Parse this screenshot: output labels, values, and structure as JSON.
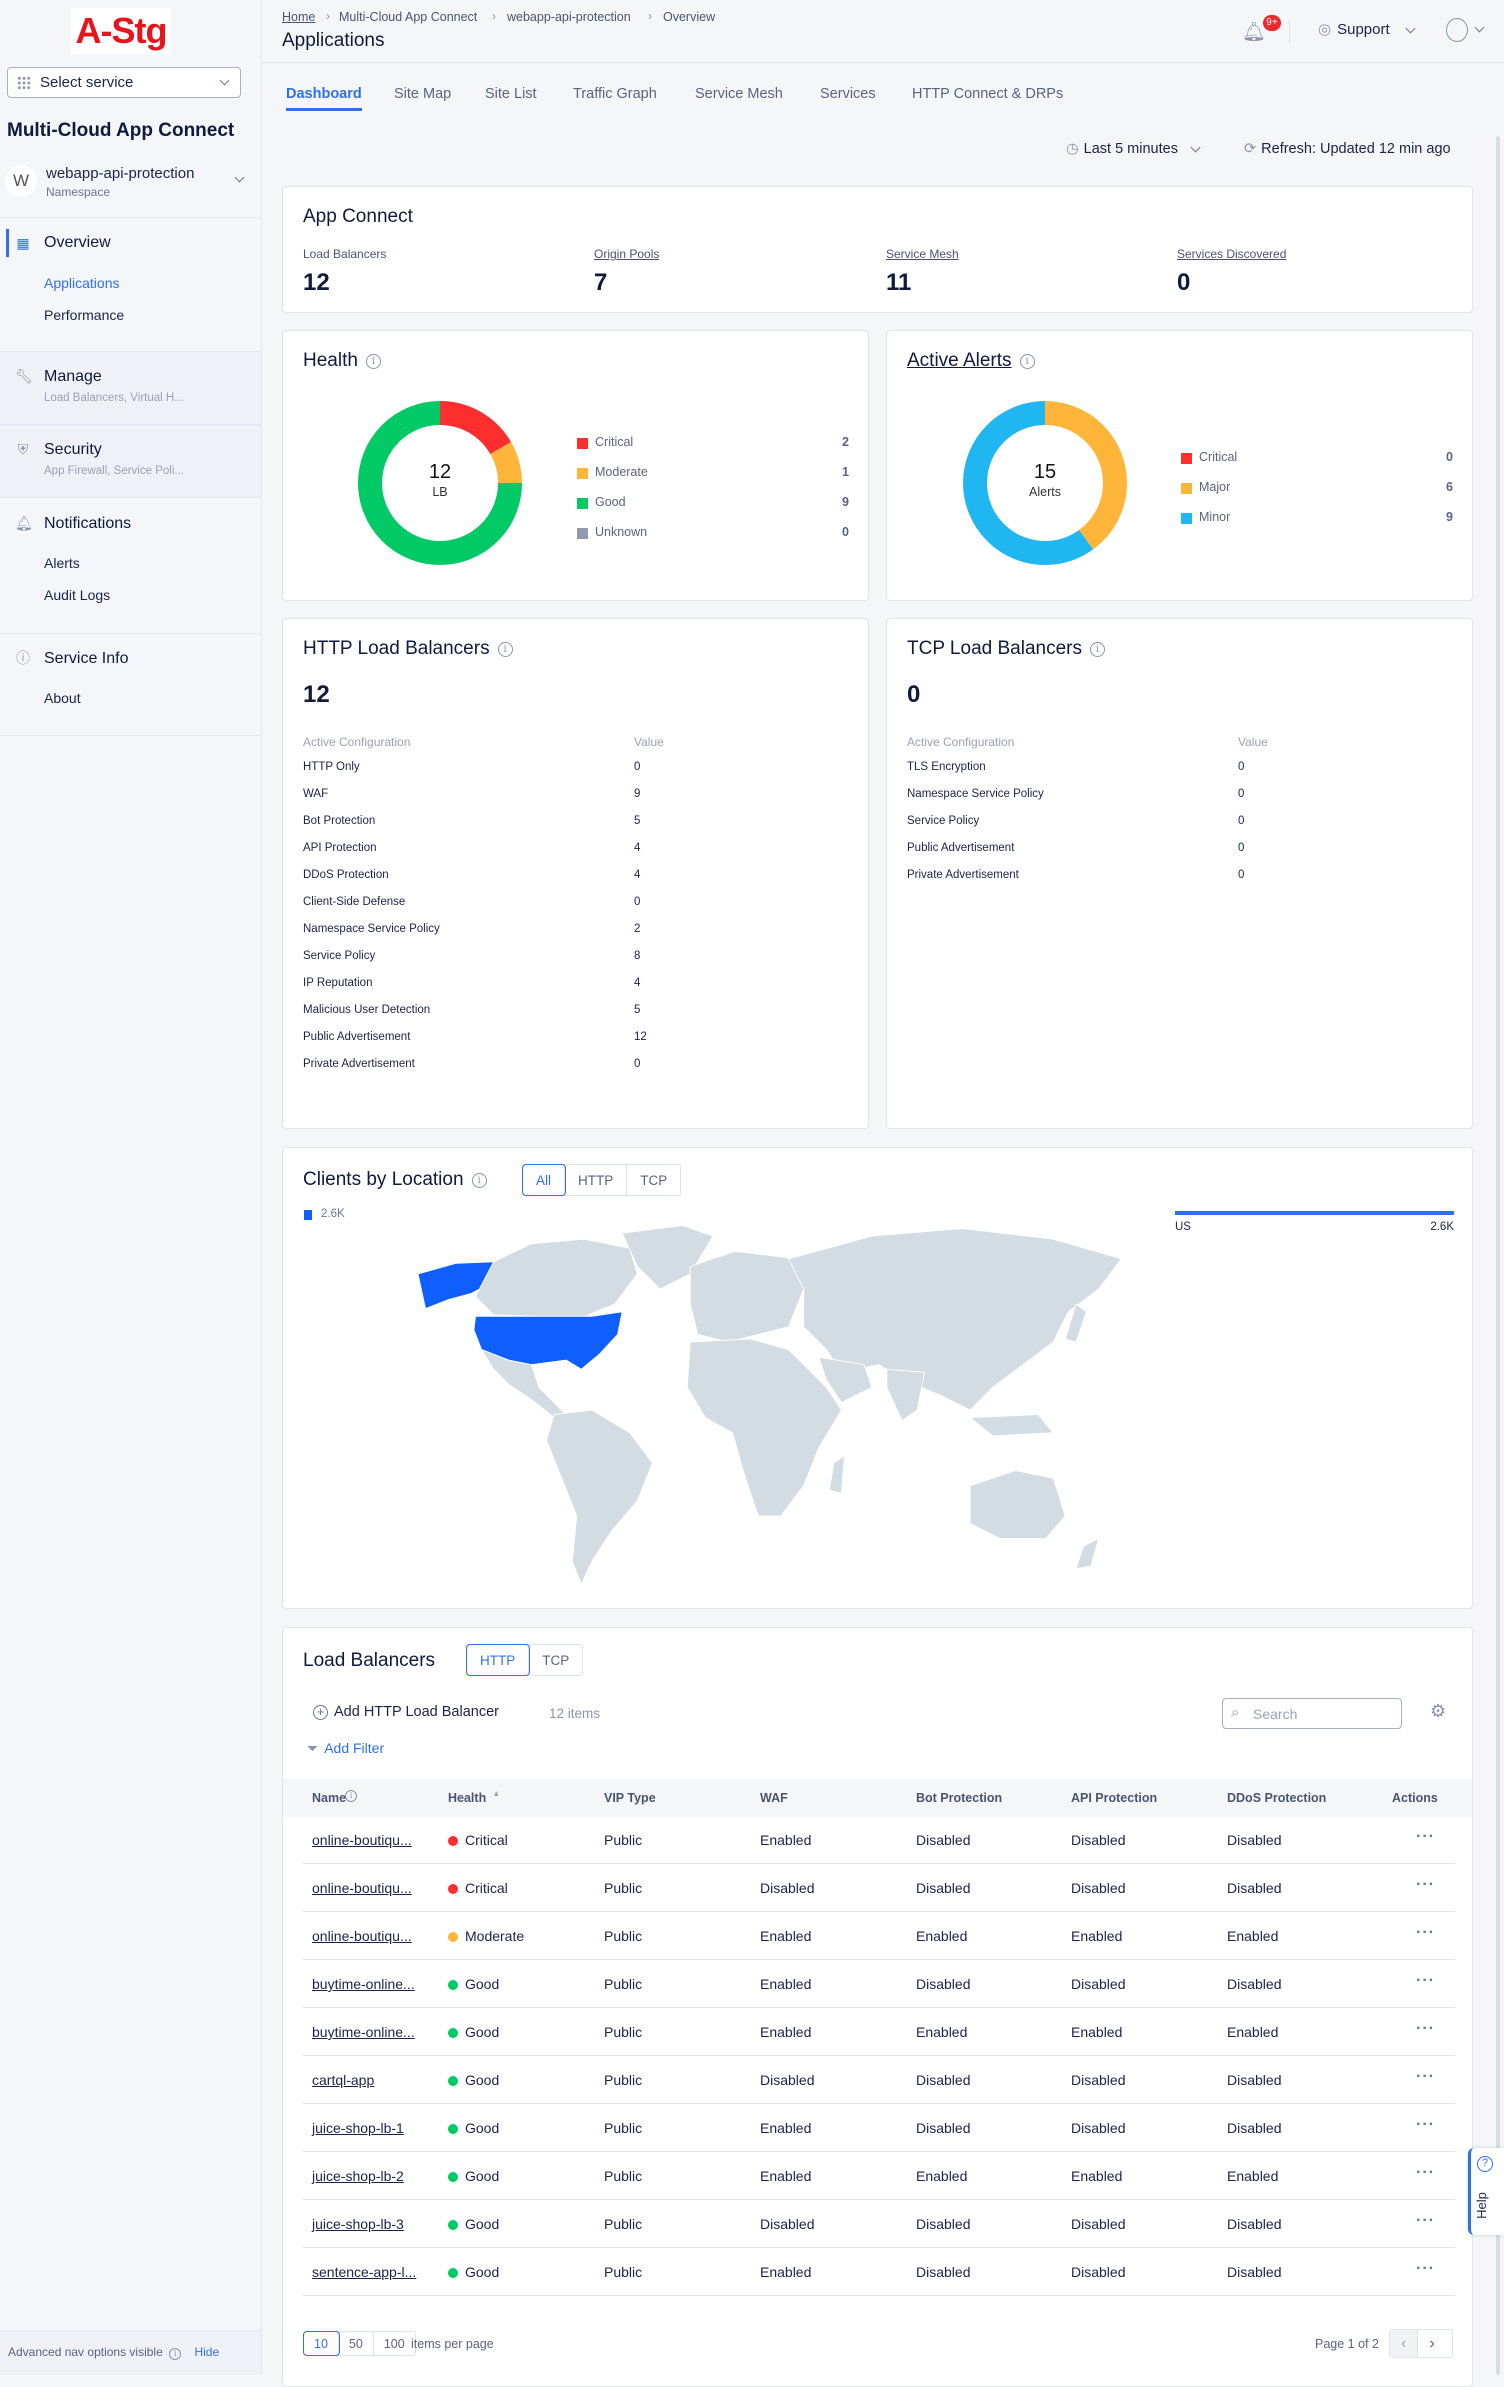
{
  "sidebar": {
    "logo_text": "A-Stg",
    "select_service": "Select service",
    "app_title": "Multi-Cloud App Connect",
    "namespace": {
      "initial": "W",
      "name": "webapp-api-protection",
      "label": "Namespace"
    },
    "overview": {
      "label": "Overview",
      "items": [
        "Applications",
        "Performance"
      ],
      "active_item": "Applications"
    },
    "manage": {
      "label": "Manage",
      "sub": "Load Balancers, Virtual H..."
    },
    "security": {
      "label": "Security",
      "sub": "App Firewall, Service Poli..."
    },
    "notifications": {
      "label": "Notifications",
      "items": [
        "Alerts",
        "Audit Logs"
      ]
    },
    "service_info": {
      "label": "Service Info",
      "items": [
        "About"
      ]
    },
    "footer": {
      "text": "Advanced nav options visible",
      "hide": "Hide"
    }
  },
  "header": {
    "breadcrumb": [
      "Home",
      "Multi-Cloud App Connect",
      "webapp-api-protection",
      "Overview"
    ],
    "title": "Applications",
    "notification_badge": "9+",
    "support": "Support",
    "tabs": [
      "Dashboard",
      "Site Map",
      "Site List",
      "Traffic Graph",
      "Service Mesh",
      "Services",
      "HTTP Connect & DRPs"
    ],
    "active_tab": "Dashboard"
  },
  "toolbar": {
    "time_range": "Last 5 minutes",
    "refresh": "Refresh: Updated 12 min ago"
  },
  "app_connect": {
    "title": "App Connect",
    "stats": [
      {
        "label": "Load Balancers",
        "value": "12",
        "link": false
      },
      {
        "label": "Origin Pools",
        "value": "7",
        "link": true
      },
      {
        "label": "Service Mesh",
        "value": "11",
        "link": true
      },
      {
        "label": "Services Discovered",
        "value": "0",
        "link": true
      }
    ]
  },
  "health": {
    "title": "Health",
    "center_value": "12",
    "center_label": "LB",
    "items": [
      {
        "label": "Critical",
        "value": 2,
        "color": "#ff2e2e"
      },
      {
        "label": "Moderate",
        "value": 1,
        "color": "#ffb53a"
      },
      {
        "label": "Good",
        "value": 9,
        "color": "#00c965"
      },
      {
        "label": "Unknown",
        "value": 0,
        "color": "#9099ad"
      }
    ]
  },
  "alerts": {
    "title": "Active Alerts",
    "center_value": "15",
    "center_label": "Alerts",
    "items": [
      {
        "label": "Critical",
        "value": 0,
        "color": "#ff2e2e"
      },
      {
        "label": "Major",
        "value": 6,
        "color": "#ffb53a"
      },
      {
        "label": "Minor",
        "value": 9,
        "color": "#1fb6f2"
      }
    ]
  },
  "http_lb": {
    "title": "HTTP Load Balancers",
    "total": "12",
    "col_config": "Active Configuration",
    "col_value": "Value",
    "rows": [
      [
        "HTTP Only",
        "0"
      ],
      [
        "WAF",
        "9"
      ],
      [
        "Bot Protection",
        "5"
      ],
      [
        "API Protection",
        "4"
      ],
      [
        "DDoS Protection",
        "4"
      ],
      [
        "Client-Side Defense",
        "0"
      ],
      [
        "Namespace Service Policy",
        "2"
      ],
      [
        "Service Policy",
        "8"
      ],
      [
        "IP Reputation",
        "4"
      ],
      [
        "Malicious User Detection",
        "5"
      ],
      [
        "Public Advertisement",
        "12"
      ],
      [
        "Private Advertisement",
        "0"
      ]
    ]
  },
  "tcp_lb": {
    "title": "TCP Load Balancers",
    "total": "0",
    "col_config": "Active Configuration",
    "col_value": "Value",
    "rows": [
      [
        "TLS Encryption",
        "0"
      ],
      [
        "Namespace Service Policy",
        "0"
      ],
      [
        "Service Policy",
        "0"
      ],
      [
        "Public Advertisement",
        "0"
      ],
      [
        "Private Advertisement",
        "0"
      ]
    ]
  },
  "clients": {
    "title": "Clients by Location",
    "filters": [
      "All",
      "HTTP",
      "TCP"
    ],
    "active_filter": "All",
    "legend_value": "2.6K",
    "top_country": "US",
    "top_value": "2.6K",
    "highlight_color": "#0f5fff",
    "land_color": "#d3dbe3"
  },
  "load_balancers": {
    "title": "Load Balancers",
    "tabs": [
      "HTTP",
      "TCP"
    ],
    "active_tab": "HTTP",
    "add_label": "Add HTTP Load Balancer",
    "item_count": "12 items",
    "search_placeholder": "Search",
    "add_filter": "Add Filter",
    "columns": [
      "Name",
      "Health",
      "VIP Type",
      "WAF",
      "Bot Protection",
      "API Protection",
      "DDoS Protection",
      "Actions"
    ],
    "rows": [
      {
        "name": "online-boutiqu...",
        "health": "Critical",
        "vip": "Public",
        "waf": "Enabled",
        "bot": "Disabled",
        "api": "Disabled",
        "ddos": "Disabled"
      },
      {
        "name": "online-boutiqu...",
        "health": "Critical",
        "vip": "Public",
        "waf": "Disabled",
        "bot": "Disabled",
        "api": "Disabled",
        "ddos": "Disabled"
      },
      {
        "name": "online-boutiqu...",
        "health": "Moderate",
        "vip": "Public",
        "waf": "Enabled",
        "bot": "Enabled",
        "api": "Enabled",
        "ddos": "Enabled"
      },
      {
        "name": "buytime-online...",
        "health": "Good",
        "vip": "Public",
        "waf": "Enabled",
        "bot": "Disabled",
        "api": "Disabled",
        "ddos": "Disabled"
      },
      {
        "name": "buytime-online...",
        "health": "Good",
        "vip": "Public",
        "waf": "Enabled",
        "bot": "Enabled",
        "api": "Enabled",
        "ddos": "Enabled"
      },
      {
        "name": "cartql-app",
        "health": "Good",
        "vip": "Public",
        "waf": "Disabled",
        "bot": "Disabled",
        "api": "Disabled",
        "ddos": "Disabled"
      },
      {
        "name": "juice-shop-lb-1",
        "health": "Good",
        "vip": "Public",
        "waf": "Enabled",
        "bot": "Disabled",
        "api": "Disabled",
        "ddos": "Disabled"
      },
      {
        "name": "juice-shop-lb-2",
        "health": "Good",
        "vip": "Public",
        "waf": "Enabled",
        "bot": "Enabled",
        "api": "Enabled",
        "ddos": "Enabled"
      },
      {
        "name": "juice-shop-lb-3",
        "health": "Good",
        "vip": "Public",
        "waf": "Disabled",
        "bot": "Disabled",
        "api": "Disabled",
        "ddos": "Disabled"
      },
      {
        "name": "sentence-app-l...",
        "health": "Good",
        "vip": "Public",
        "waf": "Enabled",
        "bot": "Disabled",
        "api": "Disabled",
        "ddos": "Disabled"
      }
    ],
    "page_sizes": [
      "10",
      "50",
      "100"
    ],
    "active_page_size": "10",
    "per_page_label": "items per page",
    "page_info": "Page 1 of 2"
  },
  "help": "Help"
}
